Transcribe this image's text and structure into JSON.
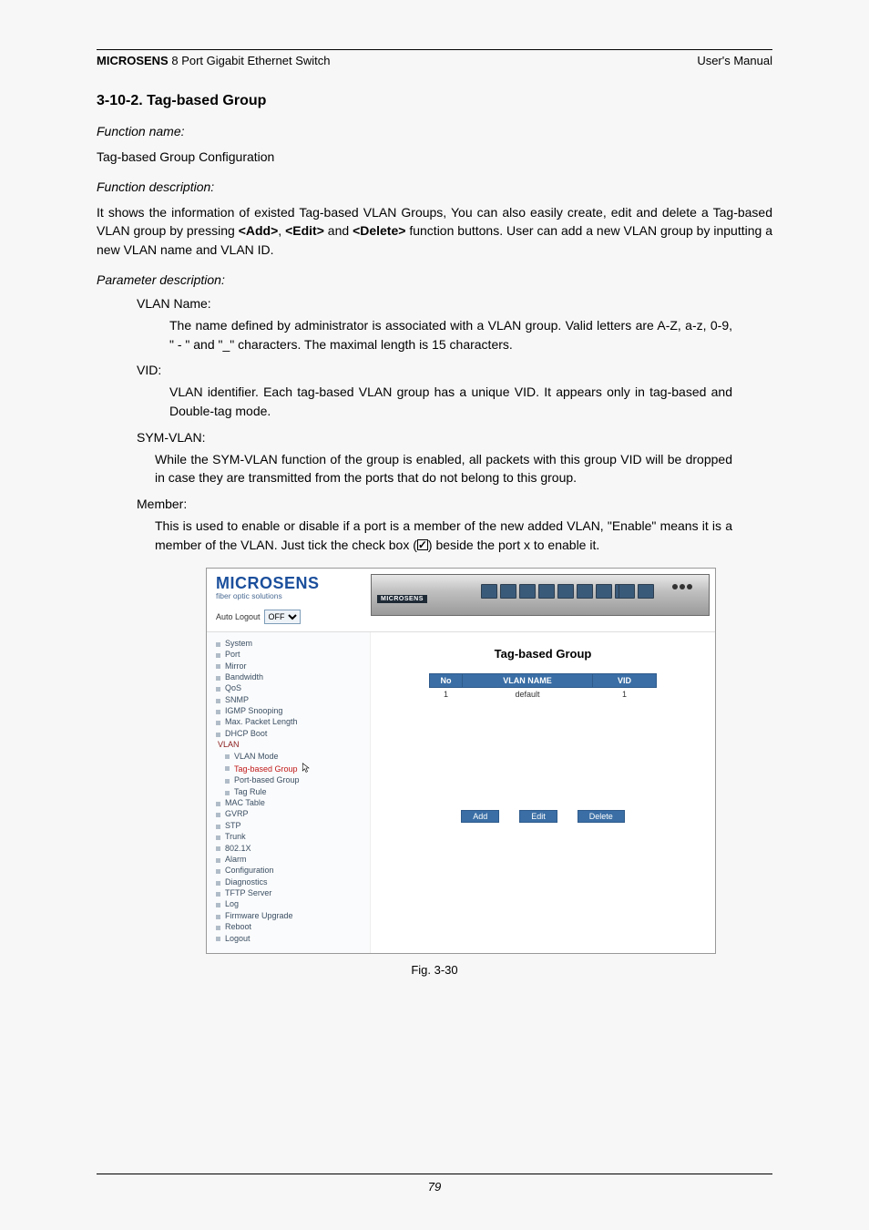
{
  "header": {
    "brand": "MICROSENS",
    "title_rest": " 8 Port Gigabit Ethernet Switch",
    "right": "User's Manual"
  },
  "section_title": "3-10-2. Tag-based Group",
  "labels": {
    "function_name": "Function name:",
    "function_name_val": "Tag-based Group Configuration",
    "function_desc": "Function description:",
    "function_desc_val": "It shows the information of existed Tag-based VLAN Groups, You can also easily create, edit and delete a Tag-based VLAN group by pressing <Add>, <Edit> and <Delete> function buttons. User can add a new VLAN group by inputting a new VLAN name and VLAN ID.",
    "function_desc_parts": {
      "p1": "It shows the information of existed Tag-based VLAN Groups, You can also easily create, edit and delete a Tag-based VLAN group by pressing ",
      "b1": "<Add>",
      "s1": ", ",
      "b2": "<Edit>",
      "s2": " and ",
      "b3": "<Delete>",
      "p2": " function buttons. User can add a new VLAN group by inputting a new VLAN name and VLAN ID."
    },
    "param_desc": "Parameter description:",
    "vlan_name_h": "VLAN Name:",
    "vlan_name_t": "The name defined by administrator is associated with a VLAN group. Valid letters are A-Z, a-z, 0-9, \" - \" and \"_\"  characters. The maximal length is 15 characters.",
    "vid_h": "VID:",
    "vid_t": "VLAN identifier. Each tag-based VLAN group has a unique VID. It appears only in tag-based and Double-tag mode.",
    "sym_h": "SYM-VLAN:",
    "sym_t": "While the SYM-VLAN function of the group is enabled, all packets with this group VID will be dropped in case they are transmitted from the ports that do not belong to this group.",
    "member_h": "Member:",
    "member_t1": "This is used to enable or disable if a port is a member of the new added VLAN, \"Enable\" means it is a member of the VLAN. Just tick the check box (",
    "member_t2": ") beside the port x to enable it."
  },
  "shot": {
    "brand": "MICROSENS",
    "brand_sub": "fiber optic solutions",
    "banner_tag": "MICROSENS",
    "autologout_label": "Auto Logout",
    "autologout_value": "OFF",
    "nav": {
      "system": "System",
      "port": "Port",
      "mirror": "Mirror",
      "bandwidth": "Bandwidth",
      "qos": "QoS",
      "snmp": "SNMP",
      "igmp": "IGMP Snooping",
      "maxpkt": "Max. Packet Length",
      "dhcp": "DHCP Boot",
      "vlan": "VLAN",
      "vlanmode": "VLAN Mode",
      "tagbased": "Tag-based Group",
      "portbased": "Port-based Group",
      "tagrule": "Tag Rule",
      "mactable": "MAC Table",
      "gvrp": "GVRP",
      "stp": "STP",
      "trunk": "Trunk",
      "dot1x": "802.1X",
      "alarm": "Alarm",
      "config": "Configuration",
      "diag": "Diagnostics",
      "tftp": "TFTP Server",
      "log": "Log",
      "fw": "Firmware Upgrade",
      "reboot": "Reboot",
      "logout": "Logout"
    },
    "content": {
      "title": "Tag-based Group",
      "th_no": "No",
      "th_name": "VLAN NAME",
      "th_vid": "VID",
      "row1_no": "1",
      "row1_name": "default",
      "row1_vid": "1",
      "btn_add": "Add",
      "btn_edit": "Edit",
      "btn_delete": "Delete"
    }
  },
  "fig_caption": "Fig. 3-30",
  "footer_page": "79"
}
